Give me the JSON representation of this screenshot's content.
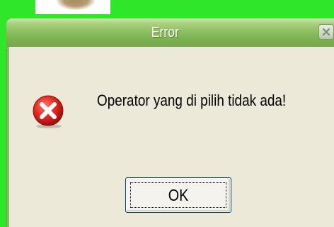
{
  "dialog": {
    "title": "Error",
    "message": "Operator yang di pilih tidak ada!",
    "ok_label": "OK",
    "icon": "error-icon",
    "close_icon": "close-icon"
  },
  "colors": {
    "desktop_background": "#2fe72a",
    "titlebar_top": "#cde7ad",
    "titlebar_bottom": "#74a84a",
    "dialog_body": "#ece9d8",
    "error_icon_red": "#d81e1e",
    "button_border": "#003c74"
  }
}
